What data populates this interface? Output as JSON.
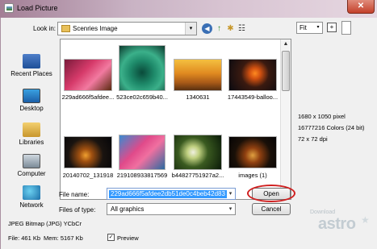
{
  "window": {
    "title": "Load Picture",
    "close_symbol": "✕"
  },
  "toolbar": {
    "look_in_label": "Look in:",
    "look_in_value": "Scenries Image",
    "dropdown_arrow": "▾",
    "back_symbol": "◀",
    "up_symbol": "↑",
    "new_folder_symbol": "✱",
    "views_symbol": "☷"
  },
  "sidebar": {
    "items": [
      {
        "label": "Recent Places",
        "icon": "recent-places-icon"
      },
      {
        "label": "Desktop",
        "icon": "desktop-icon"
      },
      {
        "label": "Libraries",
        "icon": "libraries-icon"
      },
      {
        "label": "Computer",
        "icon": "computer-icon"
      },
      {
        "label": "Network",
        "icon": "network-icon"
      }
    ]
  },
  "files": [
    {
      "caption": "229ad666f5afdee..."
    },
    {
      "caption": "523ce02c659b40..."
    },
    {
      "caption": "1340631"
    },
    {
      "caption": "17443549-balloo..."
    },
    {
      "caption": "20140702_131918"
    },
    {
      "caption": "219108933817569"
    },
    {
      "caption": "b44827751927a2..."
    },
    {
      "caption": "images (1)"
    }
  ],
  "scrollbar": {
    "up_arrow": "▲",
    "down_arrow": "▼"
  },
  "form": {
    "file_name_label": "File name:",
    "file_name_value": "229ad666f5afdee2db51de0c4beb42d83",
    "files_of_type_label": "Files of type:",
    "files_of_type_value": "All graphics",
    "open_label": "Open",
    "cancel_label": "Cancel"
  },
  "preview_panel": {
    "fit_value": "Fit",
    "zoom_symbol": "+",
    "dimensions": "1680 x 1050 pixel",
    "colors": "16777216 Colors (24 bit)",
    "dpi": "72 x 72 dpi"
  },
  "status": {
    "file_type": "JPEG Bitmap (JPG) YCbCr",
    "file_size": "File: 461 Kb",
    "memory": "Mem: 5167 Kb",
    "preview_label": "Preview",
    "preview_checked": true,
    "check_symbol": "✓"
  },
  "watermark": {
    "small": "Download",
    "big": "astro",
    "star": "★"
  }
}
